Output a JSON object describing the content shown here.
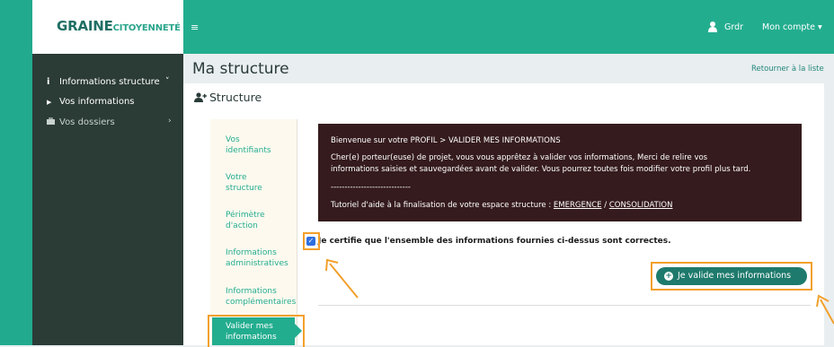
{
  "brand": {
    "logo_main": "GRAINE",
    "logo_sub": "CITOYENNETÉ",
    "accent_color": "#23ad8f",
    "sidebar_color": "#2b3b36",
    "highlight_color": "#f3a02c"
  },
  "sidebar": {
    "items": [
      {
        "label": "Informations structure",
        "icon": "info-icon",
        "chevron": "˅"
      },
      {
        "label": "Vos informations",
        "icon": "caret-right-icon"
      },
      {
        "label": "Vos dossiers",
        "icon": "briefcase-icon",
        "chevron": "›"
      }
    ]
  },
  "topbar": {
    "menu_icon": "≡",
    "user_name": "Grdr",
    "account_label": "Mon compte ▾"
  },
  "page": {
    "title": "Ma structure",
    "back_link": "Retourner à la liste",
    "panel_title": "Structure"
  },
  "tabs": [
    {
      "label": "Vos identifiants"
    },
    {
      "label": "Votre structure"
    },
    {
      "label": "Périmètre d'action"
    },
    {
      "label": "Informations administratives"
    },
    {
      "label": "Informations complémentaires"
    },
    {
      "label": "Valider mes informations"
    }
  ],
  "notice": {
    "line1": "Bienvenue sur votre PROFIL > VALIDER MES INFORMATIONS",
    "line2": "Cher(e) porteur(euse) de projet, vous vous apprêtez à valider vos informations, Merci de relire vos",
    "line3": "informations saisies et sauvegardées avant de valider. Vous pourrez toutes fois modifier votre profil plus tard.",
    "separator": "-----------------------------",
    "tutorial_prefix": "Tutoriel d'aide à la finalisation de votre espace structure : ",
    "link_emergence": "EMERGENCE",
    "link_sep": " / ",
    "link_consolidation": "CONSOLIDATION"
  },
  "certify": {
    "checked": true,
    "label": "Je certifie que l'ensemble des informations fournies ci-dessus sont correctes."
  },
  "validate_button": {
    "label": "Je valide mes informations"
  }
}
